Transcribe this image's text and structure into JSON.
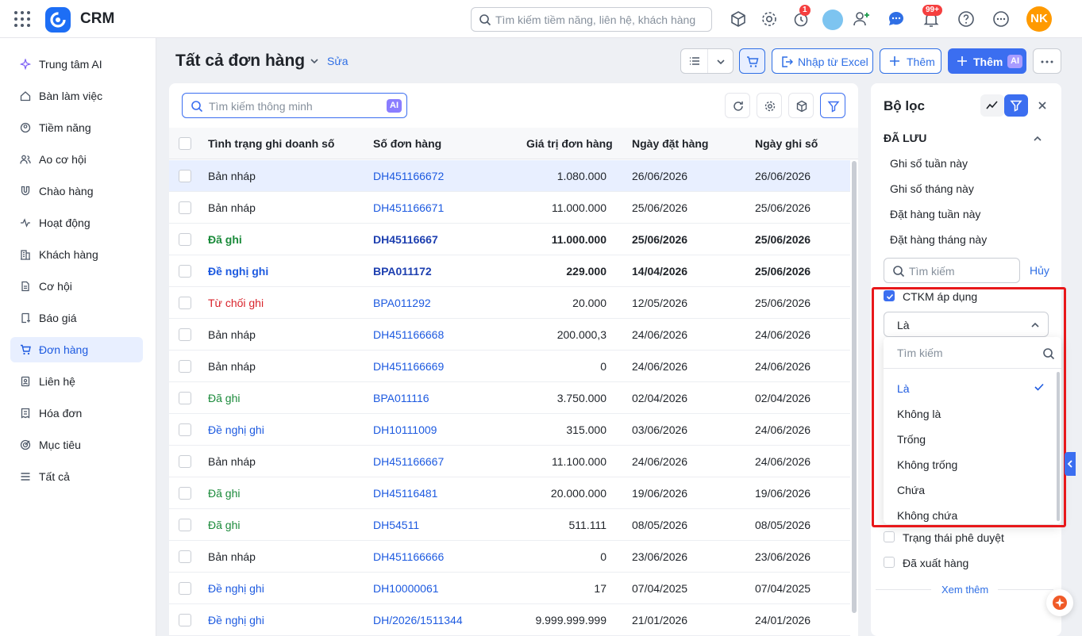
{
  "app": {
    "name": "CRM",
    "search_placeholder": "Tìm kiếm tiềm năng, liên hệ, khách hàng",
    "alarm_badge": "1",
    "notif_badge": "99+",
    "user_initials": "NK"
  },
  "sidebar": {
    "items": [
      {
        "label": "Trung tâm AI",
        "icon": "sparkle-icon"
      },
      {
        "label": "Bàn làm việc",
        "icon": "home-icon"
      },
      {
        "label": "Tiềm năng",
        "icon": "target-person-icon"
      },
      {
        "label": "Ao cơ hội",
        "icon": "people-icon"
      },
      {
        "label": "Chào hàng",
        "icon": "magnet-icon"
      },
      {
        "label": "Hoạt động",
        "icon": "activity-icon"
      },
      {
        "label": "Khách hàng",
        "icon": "building-icon"
      },
      {
        "label": "Cơ hội",
        "icon": "document-icon"
      },
      {
        "label": "Báo giá",
        "icon": "quote-icon"
      },
      {
        "label": "Đơn hàng",
        "icon": "cart-icon",
        "active": true
      },
      {
        "label": "Liên hệ",
        "icon": "contact-book-icon"
      },
      {
        "label": "Hóa đơn",
        "icon": "invoice-icon"
      },
      {
        "label": "Mục tiêu",
        "icon": "target-icon"
      },
      {
        "label": "Tất cả",
        "icon": "menu-icon"
      }
    ]
  },
  "header": {
    "title": "Tất cả đơn hàng",
    "edit": "Sửa",
    "import_excel": "Nhập từ Excel",
    "add": "Thêm",
    "add_ai": "Thêm",
    "ai_tag": "AI"
  },
  "table": {
    "search_placeholder": "Tìm kiếm thông minh",
    "columns": [
      "Tình trạng ghi doanh số",
      "Số đơn hàng",
      "Giá trị đơn hàng",
      "Ngày đặt hàng",
      "Ngày ghi số"
    ],
    "rows": [
      {
        "status": "Bản nháp",
        "code": "DH451166672",
        "value": "1.080.000",
        "order_date": "26/06/2026",
        "record_date": "26/06/2026"
      },
      {
        "status": "Bản nháp",
        "code": "DH451166671",
        "value": "11.000.000",
        "order_date": "25/06/2026",
        "record_date": "25/06/2026"
      },
      {
        "status": "Đã ghi",
        "code": "DH45116667",
        "value": "11.000.000",
        "order_date": "25/06/2026",
        "record_date": "25/06/2026"
      },
      {
        "status": "Đề nghị ghi",
        "code": "BPA011172",
        "value": "229.000",
        "order_date": "14/04/2026",
        "record_date": "25/06/2026"
      },
      {
        "status": "Từ chối ghi",
        "code": "BPA011292",
        "value": "20.000",
        "order_date": "12/05/2026",
        "record_date": "25/06/2026"
      },
      {
        "status": "Bản nháp",
        "code": "DH451166668",
        "value": "200.000,3",
        "order_date": "24/06/2026",
        "record_date": "24/06/2026"
      },
      {
        "status": "Bản nháp",
        "code": "DH451166669",
        "value": "0",
        "order_date": "24/06/2026",
        "record_date": "24/06/2026"
      },
      {
        "status": "Đã ghi",
        "code": "BPA011116",
        "value": "3.750.000",
        "order_date": "02/04/2026",
        "record_date": "02/04/2026"
      },
      {
        "status": "Đề nghị ghi",
        "code": "DH10111009",
        "value": "315.000",
        "order_date": "03/06/2026",
        "record_date": "24/06/2026"
      },
      {
        "status": "Bản nháp",
        "code": "DH451166667",
        "value": "11.100.000",
        "order_date": "24/06/2026",
        "record_date": "24/06/2026"
      },
      {
        "status": "Đã ghi",
        "code": "DH45116481",
        "value": "20.000.000",
        "order_date": "19/06/2026",
        "record_date": "19/06/2026"
      },
      {
        "status": "Đã ghi",
        "code": "DH54511",
        "value": "511.111",
        "order_date": "08/05/2026",
        "record_date": "08/05/2026"
      },
      {
        "status": "Bản nháp",
        "code": "DH451166666",
        "value": "0",
        "order_date": "23/06/2026",
        "record_date": "23/06/2026"
      },
      {
        "status": "Đề nghị ghi",
        "code": "DH10000061",
        "value": "17",
        "order_date": "07/04/2025",
        "record_date": "07/04/2025"
      },
      {
        "status": "Đề nghị ghi",
        "code": "DH/2026/1511344",
        "value": "9.999.999.999",
        "order_date": "21/01/2026",
        "record_date": "24/01/2026"
      }
    ]
  },
  "filter": {
    "title": "Bộ lọc",
    "saved_section": "ĐÃ LƯU",
    "saved": [
      "Ghi số tuần này",
      "Ghi số tháng này",
      "Đặt hàng tuần này",
      "Đặt hàng tháng này"
    ],
    "search_placeholder": "Tìm kiếm",
    "cancel": "Hủy",
    "field_ctkm": "CTKM áp dụng",
    "operator": "Là",
    "dropdown_search": "Tìm kiếm",
    "options": [
      "Là",
      "Không là",
      "Trống",
      "Không trống",
      "Chứa",
      "Không chứa"
    ],
    "field_approval": "Trạng thái phê duyệt",
    "field_shipped": "Đã xuất hàng",
    "see_more": "Xem thêm"
  },
  "colors": {
    "accent": "#3b6ef0",
    "link": "#1d5ae0",
    "green": "#1a8a3a",
    "red": "#d9232b",
    "highlight": "#e8181b"
  }
}
